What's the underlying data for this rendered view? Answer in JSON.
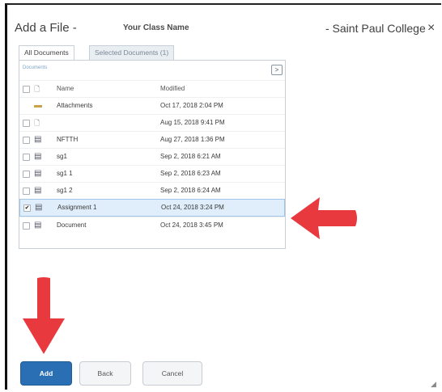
{
  "dialog": {
    "title": "Add a File -",
    "class_name": "Your Class Name",
    "college": "- Saint Paul College",
    "close_glyph": "×"
  },
  "tabs": [
    {
      "label": "All Documents",
      "active": true
    },
    {
      "label": "Selected Documents (1)",
      "active": false
    }
  ],
  "panel": {
    "breadcrumb": "Documents",
    "expand_glyph": ">"
  },
  "table": {
    "headers": {
      "name": "Name",
      "modified": "Modified"
    },
    "rows": [
      {
        "name": "Attachments",
        "modified": "Oct 17, 2018 2:04 PM",
        "icon": "folder-icon",
        "checkbox": false,
        "selected": false
      },
      {
        "name": "",
        "modified": "Aug 15, 2018 9:41 PM",
        "icon": "file-icon",
        "checkbox": true,
        "selected": false
      },
      {
        "name": "NFTTH",
        "modified": "Aug 27, 2018 1:36 PM",
        "icon": "document-icon",
        "checkbox": true,
        "selected": false
      },
      {
        "name": "sg1",
        "modified": "Sep 2, 2018 6:21 AM",
        "icon": "document-icon",
        "checkbox": true,
        "selected": false
      },
      {
        "name": "sg1 1",
        "modified": "Sep 2, 2018 6:23 AM",
        "icon": "document-icon",
        "checkbox": true,
        "selected": false
      },
      {
        "name": "sg1 2",
        "modified": "Sep 2, 2018 6:24 AM",
        "icon": "document-icon",
        "checkbox": true,
        "selected": false
      },
      {
        "name": "Assignment 1",
        "modified": "Oct 24, 2018 3:24 PM",
        "icon": "document-icon",
        "checkbox": true,
        "selected": true
      },
      {
        "name": "Document",
        "modified": "Oct 24, 2018 3:45 PM",
        "icon": "document-icon",
        "checkbox": true,
        "selected": false
      }
    ]
  },
  "buttons": {
    "add": "Add",
    "back": "Back",
    "cancel": "Cancel"
  },
  "colors": {
    "primary_button": "#2a6fb3",
    "selection_bg": "#dfeefa",
    "annotation_arrow": "#e8393f"
  }
}
